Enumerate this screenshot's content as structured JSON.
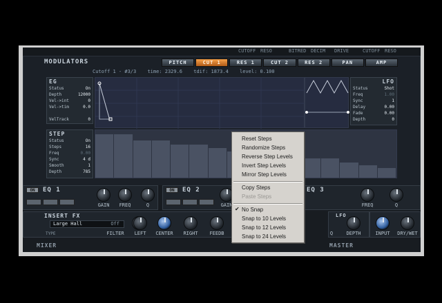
{
  "top_labels": [
    "CUTOFF",
    "RESO",
    "BITRED",
    "DECIM",
    "DRIVE",
    "CUTOFF",
    "RESO"
  ],
  "modulators": {
    "title": "MODULATORS",
    "tabs": [
      {
        "label": "PITCH",
        "active": false
      },
      {
        "label": "CUT 1",
        "active": true
      },
      {
        "label": "RES 1",
        "active": false
      },
      {
        "label": "CUT 2",
        "active": false
      },
      {
        "label": "RES 2",
        "active": false
      },
      {
        "label": "PAN",
        "active": false
      },
      {
        "label": "AMP",
        "active": false
      }
    ],
    "info": {
      "target": "Cutoff 1 - #3/3",
      "time": "time: 2329.6",
      "tdif": "tdif: 1873.4",
      "level": "level: 0.100"
    }
  },
  "eg": {
    "title": "EG",
    "params": [
      {
        "label": "Status",
        "value": "On"
      },
      {
        "label": "Depth",
        "value": "12000"
      },
      {
        "label": "Vel->int",
        "value": "0"
      },
      {
        "label": "Vel->tim",
        "value": "0.0"
      },
      {
        "label": "VelTrack",
        "value": "0"
      }
    ]
  },
  "lfo": {
    "title": "LFO",
    "params": [
      {
        "label": "Status",
        "value": "Shot"
      },
      {
        "label": "Freq",
        "value": "1.00",
        "dim": true
      },
      {
        "label": "Sync",
        "value": "1"
      },
      {
        "label": "Delay",
        "value": "0.00"
      },
      {
        "label": "Fade",
        "value": "0.00"
      },
      {
        "label": "Depth",
        "value": "0"
      }
    ]
  },
  "step": {
    "title": "STEP",
    "params": [
      {
        "label": "Status",
        "value": "On"
      },
      {
        "label": "Steps",
        "value": "16"
      },
      {
        "label": "Freq",
        "value": "0.00",
        "dim": true
      },
      {
        "label": "Sync",
        "value": "4 d"
      },
      {
        "label": "Smooth",
        "value": "1"
      },
      {
        "label": "Depth",
        "value": "785"
      }
    ],
    "levels": [
      0.92,
      0.92,
      0.78,
      0.78,
      0.7,
      0.7,
      0.62,
      0.55,
      0.55,
      0.48,
      0.48,
      0.4,
      0.4,
      0.32,
      0.26,
      0.2
    ]
  },
  "eq": {
    "on_label": "ON",
    "units": [
      {
        "title": "EQ 1",
        "knobs": [
          "GAIN",
          "FREQ",
          "Q"
        ]
      },
      {
        "title": "EQ 2",
        "knobs": [
          "GAIN"
        ]
      },
      {
        "title": "EQ 3",
        "knobs": [
          "FREQ",
          "Q"
        ]
      }
    ]
  },
  "insert_fx": {
    "title": "INSERT FX",
    "preset": "Large Hall",
    "state": "Off",
    "type_label": "TYPE",
    "knobs": [
      "FILTER",
      "LEFT",
      "CENTER",
      "RIGHT",
      "FEEDB"
    ]
  },
  "lfo_fx": {
    "title": "LFO",
    "knobs": [
      "Q",
      "DEPTH"
    ]
  },
  "master_fx": {
    "knobs": [
      "INPUT",
      "DRY/WET"
    ]
  },
  "sections": {
    "mixer": "MIXER",
    "master": "MASTER"
  },
  "context_menu": {
    "groups": [
      [
        {
          "label": "Reset Steps"
        },
        {
          "label": "Randomize Steps"
        },
        {
          "label": "Reverse Step Levels"
        },
        {
          "label": "Invert Step Levels"
        },
        {
          "label": "Mirror Step Levels"
        }
      ],
      [
        {
          "label": "Copy Steps"
        },
        {
          "label": "Paste Steps",
          "disabled": true
        }
      ],
      [
        {
          "label": "No Snap",
          "checked": true
        },
        {
          "label": "Snap to 10 Levels"
        },
        {
          "label": "Snap to 12 Levels"
        },
        {
          "label": "Snap to 24 Levels"
        }
      ]
    ]
  }
}
